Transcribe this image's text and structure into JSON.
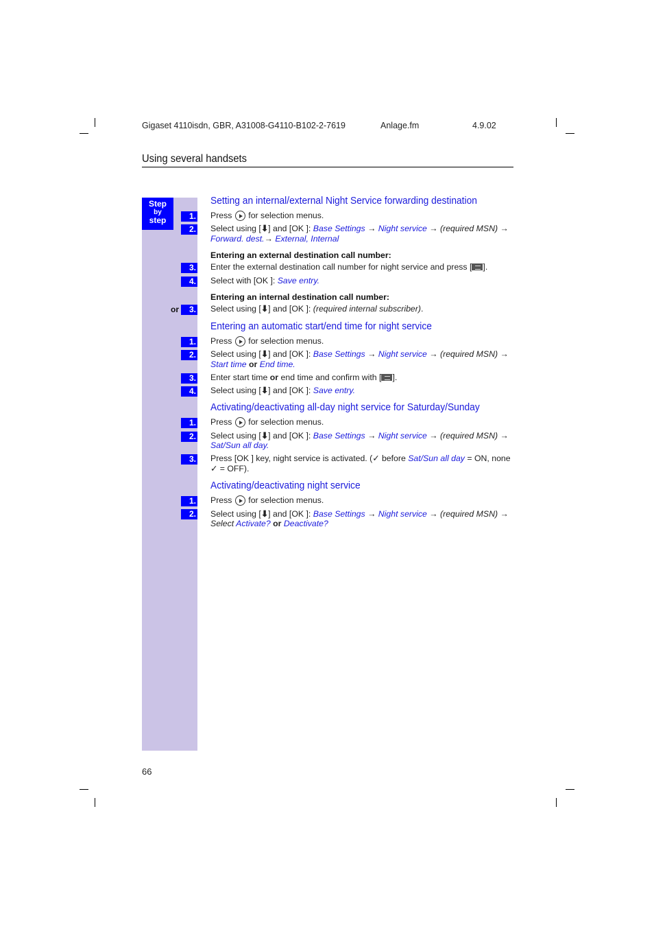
{
  "header": {
    "doc_id": "Gigaset 4110isdn, GBR, A31008-G4110-B102-2-7619",
    "file": "Anlage.fm",
    "date": "4.9.02"
  },
  "section_title": "Using several handsets",
  "step_box": {
    "line1": "Step",
    "line2": "by",
    "line3": "step"
  },
  "common": {
    "press": "Press",
    "for_selection": "for selection menus.",
    "select_using": "Select using [",
    "and_ok": "] and [OK ]: ",
    "arrow": " → ",
    "base_settings": "Base Settings",
    "night_service": "Night service",
    "required_msn": "(required MSN)",
    "down_arrow": "⬇"
  },
  "sections": [
    {
      "title": "Setting an internal/external Night Service forwarding destination",
      "step2_cont": [
        "Forward. dest.",
        "→ ",
        "External",
        ", ",
        "Internal"
      ],
      "sub_external": "Entering an external destination call number:",
      "step3_text": "Enter the external destination call number for night service and press [",
      "step3_end": "].",
      "step4_pre": "Select with [OK ]: ",
      "step4_menu": "Save entry",
      "step4_end": ".",
      "sub_internal": "Entering an internal destination call number:",
      "or_label": "or",
      "alt3_item": "(required internal subscriber)",
      "alt3_end": "."
    },
    {
      "title": "Entering an automatic start/end time for night service",
      "step2_cont_a": "Start time",
      "step2_or": " or ",
      "step2_cont_b": "End time",
      "step2_end": ".",
      "step3_pre": "Enter start time ",
      "step3_or": "or",
      "step3_post": " end time and confirm with [",
      "step3_end": "].",
      "step4_menu": "Save entry",
      "step4_end": "."
    },
    {
      "title": "Activating/deactivating all-day night service for Saturday/Sunday",
      "step2_cont": "Sat/Sun all day",
      "step2_end": ".",
      "step3_pre": "Press [OK ] key, night service is activated. (✓ before ",
      "step3_menu": "Sat/Sun all day",
      "step3_post": " = ON, none",
      "step3_line2": "✓ = OFF)."
    },
    {
      "title": "Activating/deactivating night service",
      "step2_pre": "Select ",
      "step2_a": "Activate?",
      "step2_or": " or ",
      "step2_b": "Deactivate?"
    }
  ],
  "step_numbers": [
    "1.",
    "2.",
    "3.",
    "4."
  ],
  "page_number": "66"
}
